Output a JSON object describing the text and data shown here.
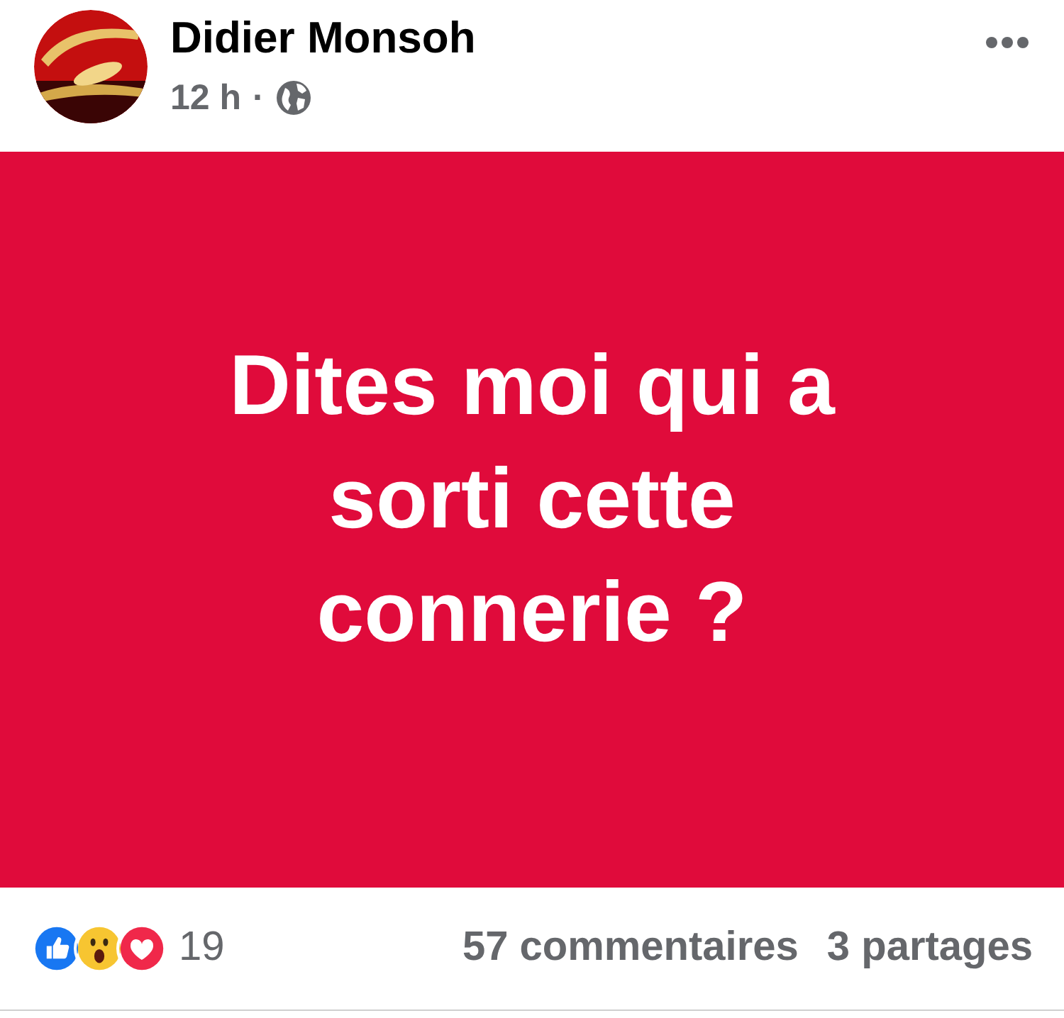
{
  "post": {
    "author": "Didier Monsoh",
    "time": "12 h",
    "separator": "·",
    "message": "Dites moi qui a sorti cette connerie ?"
  },
  "footer": {
    "reactions": [
      {
        "kind": "like"
      },
      {
        "kind": "wow"
      },
      {
        "kind": "love"
      }
    ],
    "reaction_count": "19",
    "comments": "57 commentaires",
    "shares": "3 partages"
  }
}
